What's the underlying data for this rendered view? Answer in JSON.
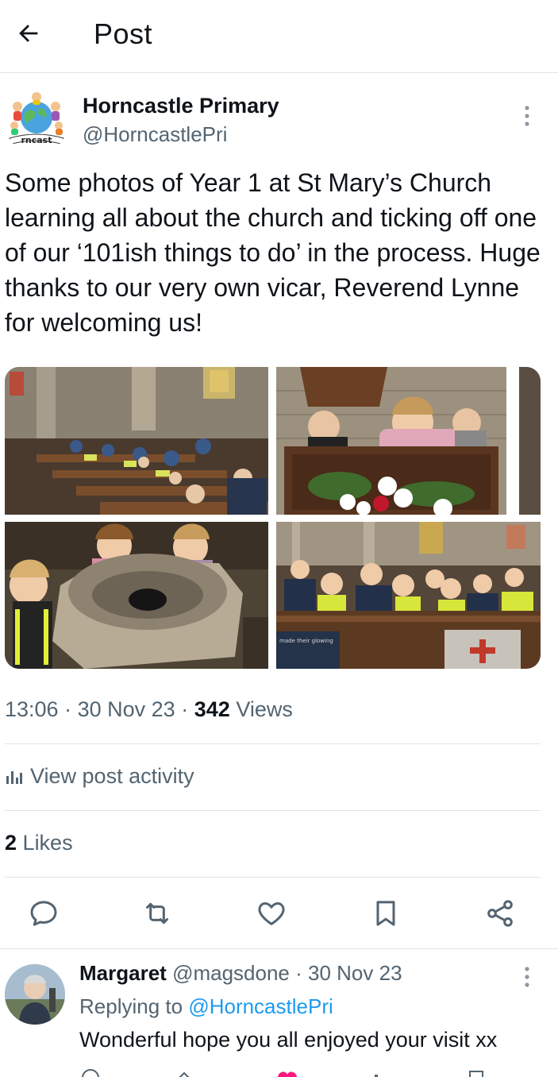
{
  "header": {
    "title": "Post",
    "back_icon": "arrow-left-icon"
  },
  "post": {
    "author_name": "Horncastle Primary",
    "author_handle": "@HorncastlePri",
    "text": "Some photos of Year 1 at St Mary’s Church learning all about the church and ticking off one of our ‘101ish things to do’ in the process. Huge thanks to our very own vicar, Reverend Lynne for welcoming us!",
    "avatar_logo_text": "rncast",
    "photos": [
      {
        "icon": "photo-church-pews"
      },
      {
        "icon": "photo-pulpit-children"
      },
      {
        "icon": "photo-baptismal-font"
      },
      {
        "icon": "photo-children-in-pews",
        "caption_fragment": "made their glowing"
      }
    ],
    "time": "13:06",
    "sep": "·",
    "date": "30 Nov 23",
    "views_count": "342",
    "views_label": "Views",
    "activity_label": "View post activity",
    "likes_count": "2",
    "likes_label": "Likes"
  },
  "actions": [
    {
      "name": "reply",
      "icon": "reply-icon"
    },
    {
      "name": "repost",
      "icon": "repost-icon"
    },
    {
      "name": "like",
      "icon": "heart-icon"
    },
    {
      "name": "bookmark",
      "icon": "bookmark-icon"
    },
    {
      "name": "share",
      "icon": "share-icon"
    }
  ],
  "reply": {
    "author_name": "Margaret",
    "author_handle": "@magsdone",
    "sep": "·",
    "date": "30 Nov 23",
    "replying_prefix": "Replying to",
    "replying_to": "@HorncastlePri",
    "text": "Wonderful hope you all enjoyed your visit xx"
  },
  "colors": {
    "accent": "#1d9bf0",
    "secondary_text": "#536471",
    "primary_text": "#0f1419",
    "divider": "#dfe3e6"
  }
}
